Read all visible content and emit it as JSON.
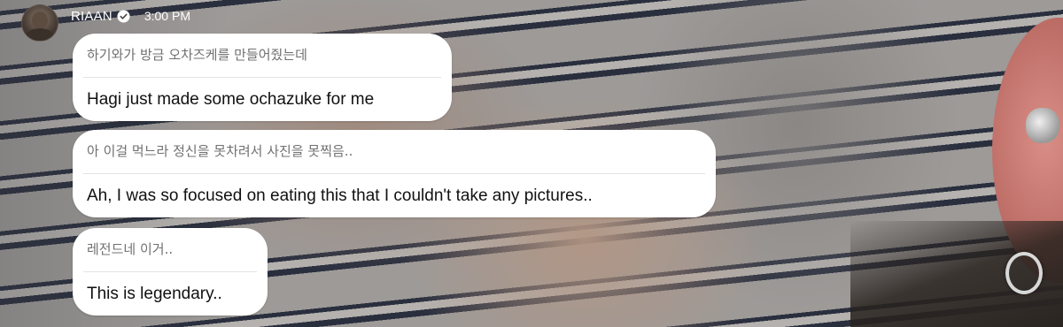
{
  "header": {
    "username": "RIAAN",
    "verified_icon": "verified-badge-icon",
    "time": "3:00 PM"
  },
  "messages": [
    {
      "original": "하기와가 방금 오차즈케를 만들어줬는데",
      "translation": "Hagi just made some ochazuke for me"
    },
    {
      "original": "아 이걸 먹느라 정신을 못차려서 사진을 못찍음..",
      "translation": "Ah, I was so focused on eating this that I couldn't take any pictures.."
    },
    {
      "original": "레전드네 이거..",
      "translation": "This is legendary.."
    }
  ],
  "colors": {
    "bubble_bg": "#ffffff",
    "original_text": "#707070",
    "translation_text": "#111111",
    "header_text": "#ffffff"
  }
}
